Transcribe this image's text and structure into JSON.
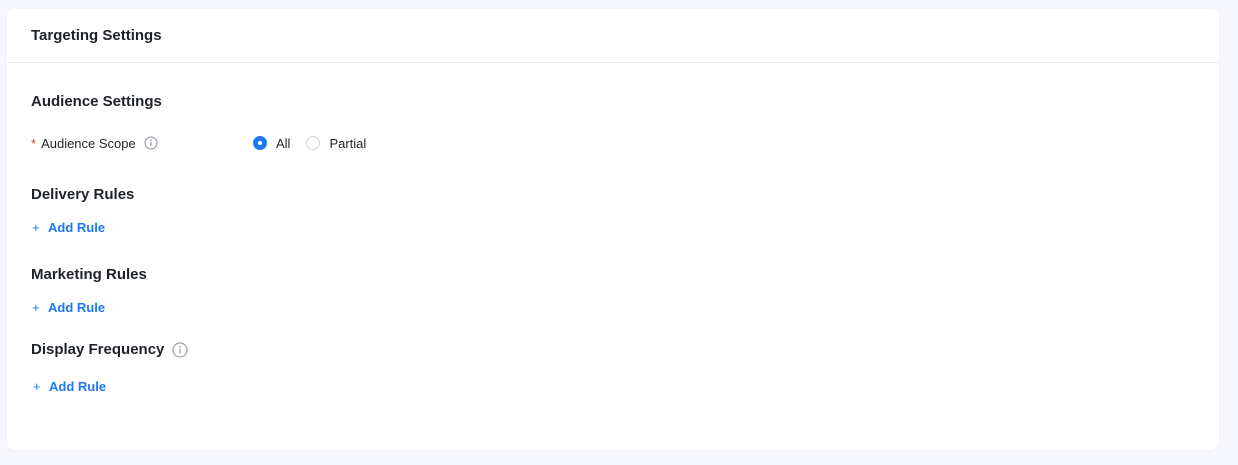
{
  "panel": {
    "title": "Targeting Settings"
  },
  "audience": {
    "section_title": "Audience Settings",
    "required_mark": "*",
    "scope_label": "Audience Scope",
    "options": [
      {
        "label": "All",
        "selected": true
      },
      {
        "label": "Partial",
        "selected": false
      }
    ]
  },
  "delivery": {
    "section_title": "Delivery Rules",
    "plus": "+",
    "add_label": "Add Rule"
  },
  "marketing": {
    "section_title": "Marketing Rules",
    "plus": "+",
    "add_label": "Add Rule"
  },
  "frequency": {
    "section_title": "Display Frequency",
    "plus": "+",
    "add_label": "Add Rule"
  },
  "colors": {
    "accent": "#1f78f0",
    "required": "#e0383e",
    "text": "#1f2329",
    "background": "#f5f7fc"
  },
  "icons": {
    "info": "info-circle-icon",
    "plus": "plus-icon"
  }
}
